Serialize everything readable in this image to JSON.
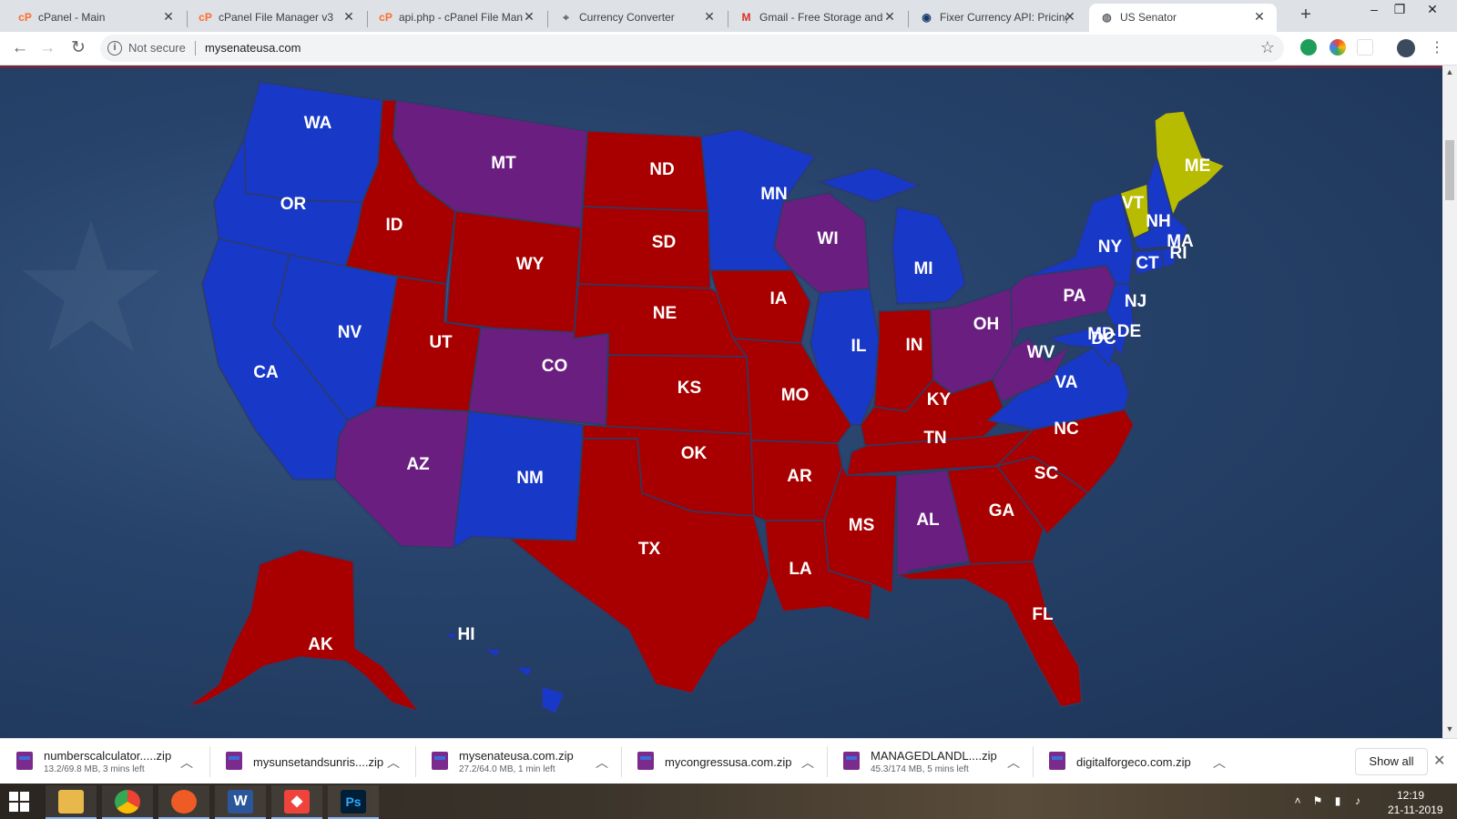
{
  "browser": {
    "tabs": [
      {
        "title": "cPanel - Main",
        "favicon": "cpanel-icon",
        "favicon_color": "#ff6c2c"
      },
      {
        "title": "cPanel File Manager v3",
        "favicon": "cpanel-icon",
        "favicon_color": "#ff6c2c"
      },
      {
        "title": "api.php - cPanel File Man",
        "favicon": "cpanel-icon",
        "favicon_color": "#ff6c2c"
      },
      {
        "title": "Currency Converter",
        "favicon": "map-pin-icon",
        "favicon_color": "#5f6368"
      },
      {
        "title": "Gmail - Free Storage and",
        "favicon": "gmail-icon",
        "favicon_color": "#d93025"
      },
      {
        "title": "Fixer Currency API: Pricing",
        "favicon": "fixer-icon",
        "favicon_color": "#1a3a6e"
      },
      {
        "title": "US Senator",
        "favicon": "globe-icon",
        "favicon_color": "#5f6368",
        "active": true
      }
    ],
    "new_tab": "+",
    "close_glyph": "✕",
    "security": "Not secure",
    "url": "mysenateusa.com"
  },
  "map": {
    "colors": {
      "democrat": "#1838c8",
      "republican": "#a80000",
      "split": "#6a1f80",
      "independent": "#b8bc00"
    },
    "state_labels": [
      "WA",
      "OR",
      "CA",
      "ID",
      "NV",
      "MT",
      "WY",
      "UT",
      "AZ",
      "CO",
      "NM",
      "ND",
      "SD",
      "NE",
      "KS",
      "OK",
      "TX",
      "MN",
      "IA",
      "MO",
      "AR",
      "LA",
      "WI",
      "IL",
      "MI",
      "IN",
      "OH",
      "KY",
      "TN",
      "MS",
      "AL",
      "GA",
      "FL",
      "SC",
      "NC",
      "VA",
      "WV",
      "PA",
      "NY",
      "VT",
      "NH",
      "ME",
      "MA",
      "CT",
      "RI",
      "NJ",
      "DE",
      "MD",
      "DC",
      "AK",
      "HI"
    ]
  },
  "downloads": [
    {
      "name": "numberscalculator.....zip",
      "status": "13.2/69.8 MB, 3 mins left"
    },
    {
      "name": "mysunsetandsunris....zip",
      "status": ""
    },
    {
      "name": "mysenateusa.com.zip",
      "status": "27.2/64.0 MB, 1 min left"
    },
    {
      "name": "mycongressusa.com.zip",
      "status": ""
    },
    {
      "name": "MANAGEDLANDL....zip",
      "status": "45.3/174 MB, 5 mins left"
    },
    {
      "name": "digitalforgeco.com.zip",
      "status": ""
    }
  ],
  "show_all": "Show all",
  "taskbar": {
    "apps": [
      {
        "name": "file-explorer-icon",
        "color": "#e8b84a"
      },
      {
        "name": "chrome-icon",
        "color": "#34a853"
      },
      {
        "name": "postman-icon",
        "color": "#ef5b25"
      },
      {
        "name": "word-icon",
        "color": "#2b579a",
        "glyph": "W"
      },
      {
        "name": "anydesk-icon",
        "color": "#ef443b"
      },
      {
        "name": "photoshop-icon",
        "color": "#001e36",
        "glyph": "Ps"
      }
    ],
    "time": "12:19",
    "date": "21-11-2019"
  }
}
